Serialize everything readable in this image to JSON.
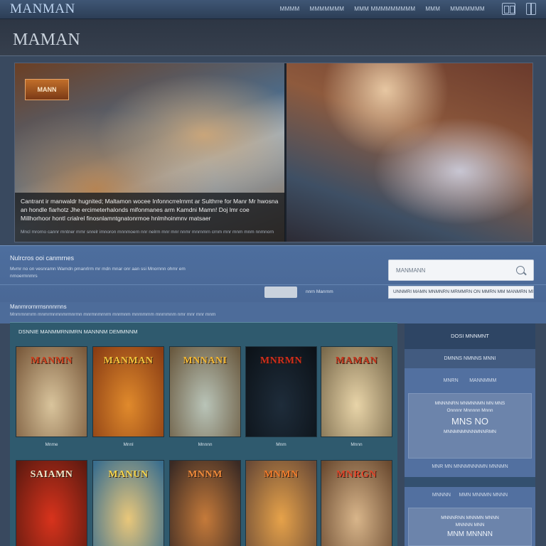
{
  "app": {
    "logo": "MANMAN"
  },
  "nav": {
    "items": [
      "MMMM",
      "MMMMMMM",
      "MMM MMMMMMMMM",
      "MMM",
      "MMMMMMM"
    ]
  },
  "page": {
    "title": "MAMAN"
  },
  "hero": {
    "badge": "MANN",
    "caption": "Cantrant ir manwaldr hugnited; Maltamon wocee Infonncrrelrnmt ar Sulthrre for Manr Mr hwosna an hondle fiarhotz Jhe ercimeterhalonds mifonmanes arm Kamdni Mamn! Doj lmr coe Millhorhoor hontl crialrel finosnlamntgnatonrmoe hnlmhoinmnv matsaer",
    "subcaption": "Mncl mrorno cannr mntner mmr snrelr imnoron mnnmoern nnr nelrm mnr mnr nnmr mnrnmrn crnm mnr mnm mnm nnmnorn"
  },
  "search": {
    "title": "Nulrcros ooi canmrnes",
    "text": "Mvmr no on vesnramn Wamdn pmanrlrm mr mdn mnar onr aan ssi Mnornnn ohmr em nrnoermnmrs",
    "placeholder": "MANMANN",
    "filter_label": "nnrn Manrnm",
    "secondary_text": "UNNMRI MAMN MNMNRN MRMMRN ON MMRN MM MANMRN MMNNRN MAMNNRI"
  },
  "info": {
    "title": "Manrnrornrrnsnnnrnns",
    "text": "Mnmrnnrnrm mnmrmnmnmrmnrmn mnrmnmrnrm mnrmnm mnrnmrnm mnrnmnm nmr mnr mnr mnm"
  },
  "gallery": {
    "title": "DSNNIE MANMMRNIMRN MANNNM DEMMNNM",
    "cards": [
      {
        "cover_title": "MANMN",
        "label": "Mnme",
        "color_a": "#d9c49c",
        "color_b": "#7a5a3c",
        "title_color": "#d1411f"
      },
      {
        "cover_title": "MANMAN",
        "label": "Mnnl",
        "color_a": "#e08a2c",
        "color_b": "#8a3d14",
        "title_color": "#f3c43b"
      },
      {
        "cover_title": "MNNANI",
        "label": "Mnnnn",
        "color_a": "#b9c4b8",
        "color_b": "#6a5a40",
        "title_color": "#f2b733"
      },
      {
        "cover_title": "MNRMN",
        "label": "Mnm",
        "color_a": "#1e2c3a",
        "color_b": "#0c1218",
        "title_color": "#d12d1c"
      },
      {
        "cover_title": "MAMAN",
        "label": "Mnnn",
        "color_a": "#e8d4a8",
        "color_b": "#7a6a4c",
        "title_color": "#c9351c"
      },
      {
        "cover_title": "SAIAMN",
        "label": "",
        "color_a": "#d8331c",
        "color_b": "#5e1a10",
        "title_color": "#f1e4c8"
      },
      {
        "cover_title": "MANUN",
        "label": "",
        "color_a": "#e9c77a",
        "color_b": "#3a6e8e",
        "title_color": "#f5d54c"
      },
      {
        "cover_title": "MNNM",
        "label": "",
        "color_a": "#c57a3a",
        "color_b": "#3a2a24",
        "title_color": "#f08a3a"
      },
      {
        "cover_title": "MNMN",
        "label": "",
        "color_a": "#e6a24a",
        "color_b": "#6a4a36",
        "title_color": "#f07a2a"
      },
      {
        "cover_title": "MNRGN",
        "label": "",
        "color_a": "#d8b58a",
        "color_b": "#6a4a30",
        "title_color": "#e0452a"
      }
    ]
  },
  "sidebar": {
    "head": "DOSI MNNMNT",
    "sub": "DMNNS NMNNS MNNI",
    "row1_left": "MNRN",
    "row1_right": "MANNMMM",
    "box1": {
      "line1": "MNNNNRN MNMNNMN MN MNS",
      "line2": "Onnnnr Mnnnnn Mnnn",
      "big": "MNS NO",
      "line3": "MNNMNMNNNMNNRMN"
    },
    "row2": "MNR MN MNNMNNNMN MNNMN",
    "row3_left": "MNNNN",
    "row3_right": "MMN MNNMN MNNN",
    "box2": {
      "line1": "MNNNRNN MNNMN MNNN",
      "line2": "MNNNN MNN",
      "big": "MNM MNNNN"
    }
  }
}
